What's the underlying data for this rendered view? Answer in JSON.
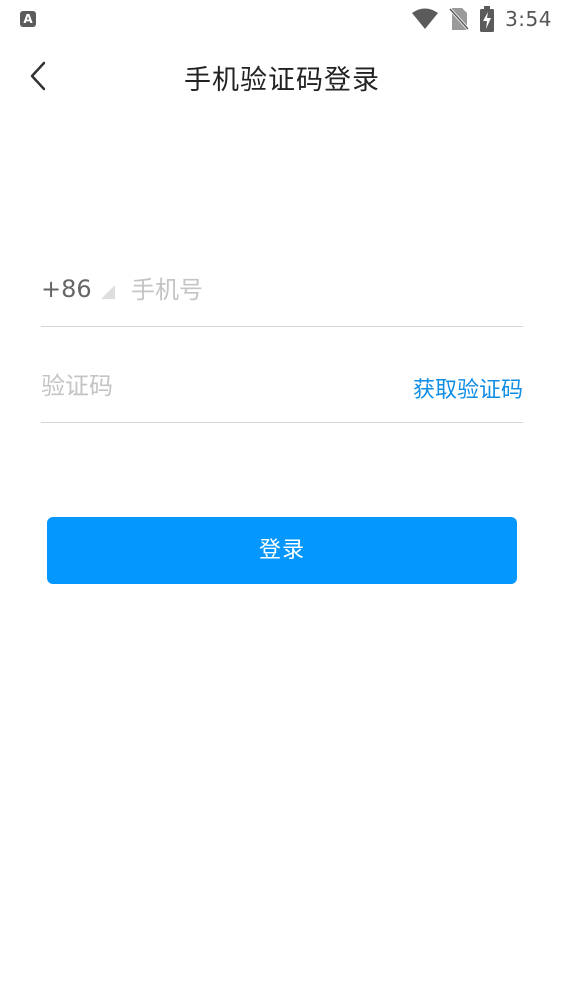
{
  "status_bar": {
    "app_icon_letter": "A",
    "time": "3:54"
  },
  "header": {
    "title": "手机验证码登录"
  },
  "form": {
    "country_code": "+86",
    "phone_placeholder": "手机号",
    "code_placeholder": "验证码",
    "get_code_label": "获取验证码",
    "login_label": "登录"
  },
  "colors": {
    "accent": "#0497fd",
    "link": "#0f8ee6",
    "placeholder": "#c4c4c4",
    "divider": "#d6d6d6"
  },
  "icons": {
    "status": [
      "wifi-icon",
      "no-sim-icon",
      "battery-charging-icon"
    ],
    "header": "back-arrow-icon",
    "country": "dropdown-caret-icon"
  }
}
